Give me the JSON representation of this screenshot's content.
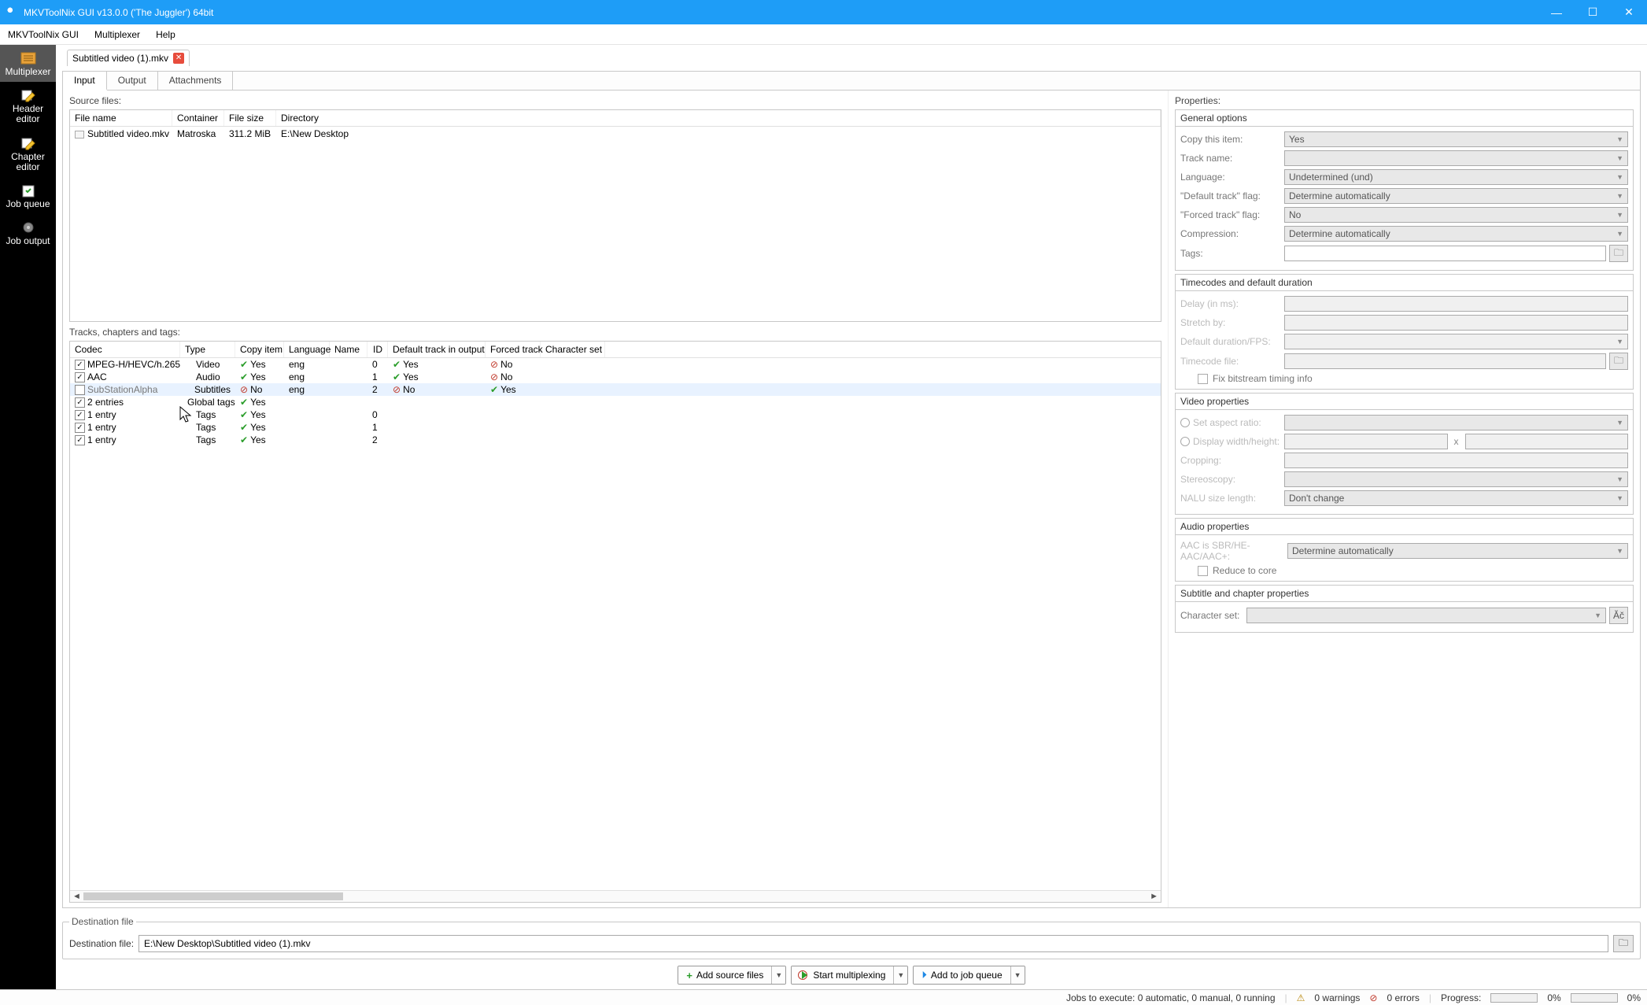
{
  "window": {
    "title": "MKVToolNix GUI v13.0.0 ('The Juggler') 64bit"
  },
  "menubar": [
    "MKVToolNix GUI",
    "Multiplexer",
    "Help"
  ],
  "sidebar": [
    {
      "label": "Multiplexer",
      "active": true
    },
    {
      "label": "Header editor"
    },
    {
      "label": "Chapter editor"
    },
    {
      "label": "Job queue"
    },
    {
      "label": "Job output"
    }
  ],
  "doc_tab": {
    "label": "Subtitled video (1).mkv"
  },
  "inner_tabs": [
    "Input",
    "Output",
    "Attachments"
  ],
  "source_files": {
    "label": "Source files:",
    "headers": [
      "File name",
      "Container",
      "File size",
      "Directory"
    ],
    "rows": [
      {
        "name": "Subtitled video.mkv",
        "container": "Matroska",
        "size": "311.2 MiB",
        "dir": "E:\\New Desktop"
      }
    ]
  },
  "tracks": {
    "label": "Tracks, chapters and tags:",
    "headers": [
      "Codec",
      "Type",
      "Copy item",
      "Language",
      "Name",
      "ID",
      "Default track in output",
      "Forced track",
      "Character set"
    ],
    "rows": [
      {
        "chk": true,
        "codec": "MPEG-H/HEVC/h.265",
        "type": "Video",
        "copy": "Yes",
        "lang": "eng",
        "name": "",
        "id": "0",
        "def": "Yes",
        "forced": "No",
        "cs": ""
      },
      {
        "chk": true,
        "codec": "AAC",
        "type": "Audio",
        "copy": "Yes",
        "lang": "eng",
        "name": "",
        "id": "1",
        "def": "Yes",
        "forced": "No",
        "cs": ""
      },
      {
        "chk": false,
        "codec": "SubStationAlpha",
        "type": "Subtitles",
        "copy": "No",
        "lang": "eng",
        "name": "",
        "id": "2",
        "def": "No",
        "forced": "Yes",
        "cs": "",
        "selected": true
      },
      {
        "chk": true,
        "codec": "2 entries",
        "type": "Global tags",
        "copy": "Yes",
        "lang": "",
        "name": "",
        "id": "",
        "def": "",
        "forced": "",
        "cs": ""
      },
      {
        "chk": true,
        "codec": "1 entry",
        "type": "Tags",
        "copy": "Yes",
        "lang": "",
        "name": "",
        "id": "0",
        "def": "",
        "forced": "",
        "cs": ""
      },
      {
        "chk": true,
        "codec": "1 entry",
        "type": "Tags",
        "copy": "Yes",
        "lang": "",
        "name": "",
        "id": "1",
        "def": "",
        "forced": "",
        "cs": ""
      },
      {
        "chk": true,
        "codec": "1 entry",
        "type": "Tags",
        "copy": "Yes",
        "lang": "",
        "name": "",
        "id": "2",
        "def": "",
        "forced": "",
        "cs": ""
      }
    ]
  },
  "properties": {
    "title": "Properties:",
    "general": {
      "title": "General options",
      "copy_this_label": "Copy this item:",
      "copy_this_value": "Yes",
      "track_name_label": "Track name:",
      "track_name_value": "",
      "language_label": "Language:",
      "language_value": "Undetermined (und)",
      "default_flag_label": "\"Default track\" flag:",
      "default_flag_value": "Determine automatically",
      "forced_flag_label": "\"Forced track\" flag:",
      "forced_flag_value": "No",
      "compression_label": "Compression:",
      "compression_value": "Determine automatically",
      "tags_label": "Tags:",
      "tags_value": ""
    },
    "time": {
      "title": "Timecodes and default duration",
      "delay_label": "Delay (in ms):",
      "delay_value": "",
      "stretch_label": "Stretch by:",
      "stretch_value": "",
      "fps_label": "Default duration/FPS:",
      "fps_value": "",
      "tcfile_label": "Timecode file:",
      "tcfile_value": "",
      "fix_label": "Fix bitstream timing info"
    },
    "video": {
      "title": "Video properties",
      "aspect_label": "Set aspect ratio:",
      "aspect_value": "",
      "wh_label": "Display width/height:",
      "w": "",
      "h": "",
      "cropping_label": "Cropping:",
      "cropping_value": "",
      "stereo_label": "Stereoscopy:",
      "stereo_value": "",
      "nalu_label": "NALU size length:",
      "nalu_value": "Don't change"
    },
    "audio": {
      "title": "Audio properties",
      "aac_label": "AAC is SBR/HE-AAC/AAC+:",
      "aac_value": "Determine automatically",
      "reduce_label": "Reduce to core"
    },
    "sub": {
      "title": "Subtitle and chapter properties",
      "cs_label": "Character set:",
      "cs_value": ""
    }
  },
  "destination": {
    "group": "Destination file",
    "label": "Destination file:",
    "value": "E:\\New Desktop\\Subtitled video (1).mkv"
  },
  "actions": {
    "add": "Add source files",
    "start": "Start multiplexing",
    "queue": "Add to job queue"
  },
  "status": {
    "jobs": "Jobs to execute: 0 automatic, 0 manual, 0 running",
    "warnings": "0 warnings",
    "errors": "0 errors",
    "progress_label": "Progress:",
    "progress_pct": "0%"
  }
}
